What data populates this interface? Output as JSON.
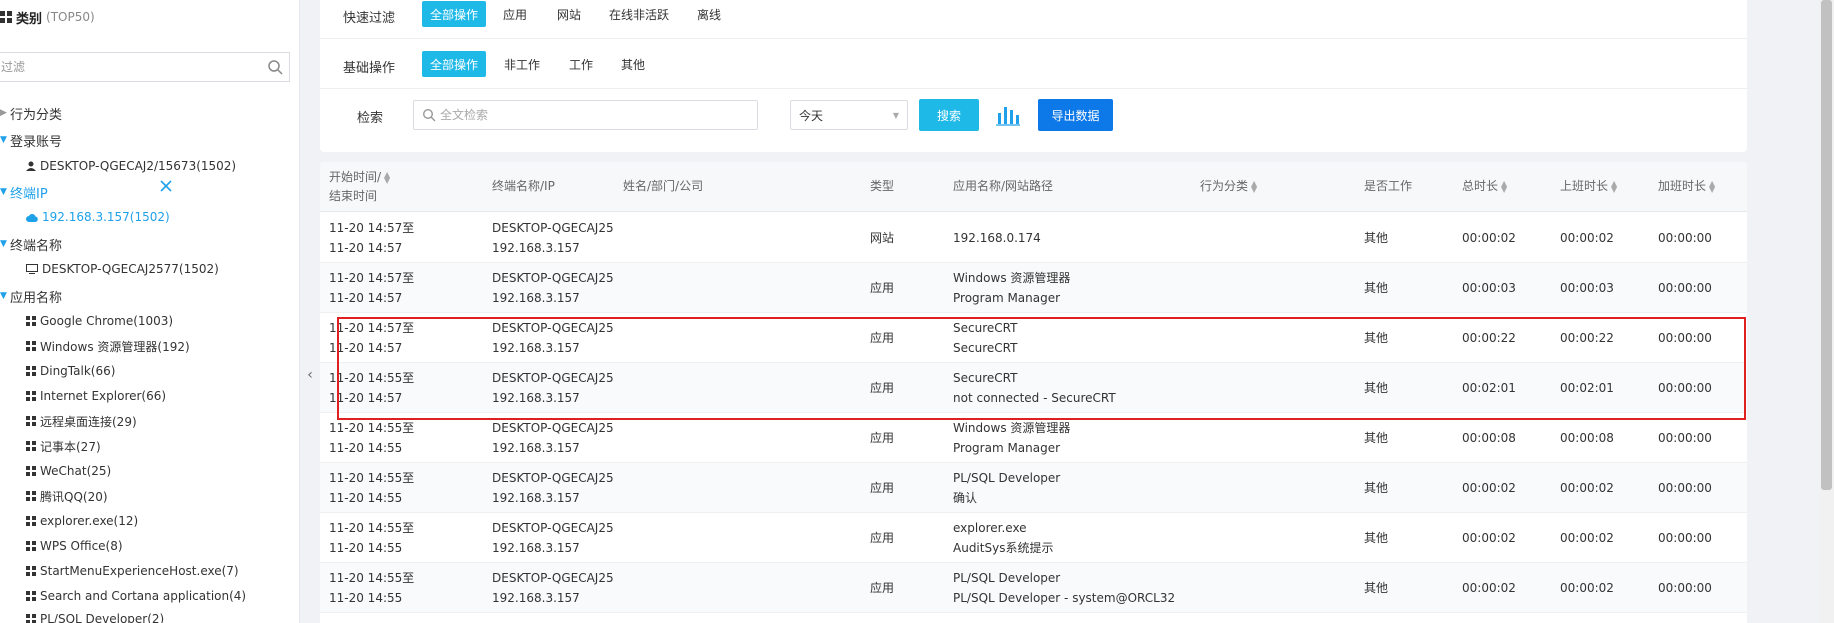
{
  "sidebar": {
    "title": "类别",
    "title_sub": "(TOP50)",
    "filter_placeholder": "过滤",
    "groups": [
      {
        "label": "行为分类",
        "open": false,
        "items": []
      },
      {
        "label": "登录账号",
        "open": true,
        "items": [
          {
            "label": "DESKTOP-QGECAJ2/15673(1502)",
            "icon": "user-icon"
          }
        ]
      },
      {
        "label": "终端IP",
        "open": true,
        "active": true,
        "items": [
          {
            "label": "192.168.3.157(1502)",
            "icon": "cloud-icon",
            "active": true
          }
        ]
      },
      {
        "label": "终端名称",
        "open": true,
        "items": [
          {
            "label": "DESKTOP-QGECAJ2577(1502)",
            "icon": "monitor-icon"
          }
        ]
      },
      {
        "label": "应用名称",
        "open": true,
        "items": [
          {
            "label": "Google Chrome(1003)"
          },
          {
            "label": "Windows 资源管理器(192)"
          },
          {
            "label": "DingTalk(66)"
          },
          {
            "label": "Internet Explorer(66)"
          },
          {
            "label": "远程桌面连接(29)"
          },
          {
            "label": "记事本(27)"
          },
          {
            "label": "WeChat(25)"
          },
          {
            "label": "腾讯QQ(20)"
          },
          {
            "label": "explorer.exe(12)"
          },
          {
            "label": "WPS Office(8)"
          },
          {
            "label": "StartMenuExperienceHost.exe(7)"
          },
          {
            "label": "Search and Cortana application(4)"
          },
          {
            "label": "PL/SQL Developer(2)"
          }
        ]
      }
    ]
  },
  "filters": {
    "quick_label": "快速过滤",
    "quick_options": [
      "全部操作",
      "应用",
      "网站",
      "在线非活跃",
      "离线"
    ],
    "basic_label": "基础操作",
    "basic_options": [
      "全部操作",
      "非工作",
      "工作",
      "其他"
    ],
    "search_label": "检索",
    "search_placeholder": "全文检索",
    "date_value": "今天",
    "search_button": "搜索",
    "export_button": "导出数据"
  },
  "table": {
    "columns": {
      "time_line1": "开始时间/",
      "time_line2": "结束时间",
      "terminal": "终端名称/IP",
      "person": "姓名/部门/公司",
      "type": "类型",
      "app": "应用名称/网站路径",
      "category": "行为分类",
      "is_work": "是否工作",
      "total": "总时长",
      "work_time": "上班时长",
      "overtime": "加班时长"
    },
    "rows": [
      {
        "start": "11-20 14:57至",
        "end": "11-20 14:57",
        "host": "DESKTOP-QGECAJ25",
        "ip": "192.168.3.157",
        "type": "网站",
        "app1": "192.168.0.174",
        "app2": "",
        "work": "其他",
        "total": "00:00:02",
        "on": "00:00:02",
        "over": "00:00:00"
      },
      {
        "start": "11-20 14:57至",
        "end": "11-20 14:57",
        "host": "DESKTOP-QGECAJ25",
        "ip": "192.168.3.157",
        "type": "应用",
        "app1": "Windows 资源管理器",
        "app2": "Program Manager",
        "work": "其他",
        "total": "00:00:03",
        "on": "00:00:03",
        "over": "00:00:00"
      },
      {
        "start": "11-20 14:57至",
        "end": "11-20 14:57",
        "host": "DESKTOP-QGECAJ25",
        "ip": "192.168.3.157",
        "type": "应用",
        "app1": "SecureCRT",
        "app2": "SecureCRT",
        "work": "其他",
        "total": "00:00:22",
        "on": "00:00:22",
        "over": "00:00:00"
      },
      {
        "start": "11-20 14:55至",
        "end": "11-20 14:57",
        "host": "DESKTOP-QGECAJ25",
        "ip": "192.168.3.157",
        "type": "应用",
        "app1": "SecureCRT",
        "app2": "not connected - SecureCRT",
        "work": "其他",
        "total": "00:02:01",
        "on": "00:02:01",
        "over": "00:00:00"
      },
      {
        "start": "11-20 14:55至",
        "end": "11-20 14:55",
        "host": "DESKTOP-QGECAJ25",
        "ip": "192.168.3.157",
        "type": "应用",
        "app1": "Windows 资源管理器",
        "app2": "Program Manager",
        "work": "其他",
        "total": "00:00:08",
        "on": "00:00:08",
        "over": "00:00:00"
      },
      {
        "start": "11-20 14:55至",
        "end": "11-20 14:55",
        "host": "DESKTOP-QGECAJ25",
        "ip": "192.168.3.157",
        "type": "应用",
        "app1": "PL/SQL Developer",
        "app2": "确认",
        "work": "其他",
        "total": "00:00:02",
        "on": "00:00:02",
        "over": "00:00:00"
      },
      {
        "start": "11-20 14:55至",
        "end": "11-20 14:55",
        "host": "DESKTOP-QGECAJ25",
        "ip": "192.168.3.157",
        "type": "应用",
        "app1": "explorer.exe",
        "app2": "AuditSys系统提示",
        "work": "其他",
        "total": "00:00:02",
        "on": "00:00:02",
        "over": "00:00:00"
      },
      {
        "start": "11-20 14:55至",
        "end": "11-20 14:55",
        "host": "DESKTOP-QGECAJ25",
        "ip": "192.168.3.157",
        "type": "应用",
        "app1": "PL/SQL Developer",
        "app2": "PL/SQL Developer - system@ORCL32",
        "work": "其他",
        "total": "00:00:02",
        "on": "00:00:02",
        "over": "00:00:00"
      }
    ]
  },
  "colors": {
    "accent": "#1fb9e8",
    "export": "#0d78e8",
    "active_text": "#1fa1ea",
    "highlight": "#e02020"
  }
}
